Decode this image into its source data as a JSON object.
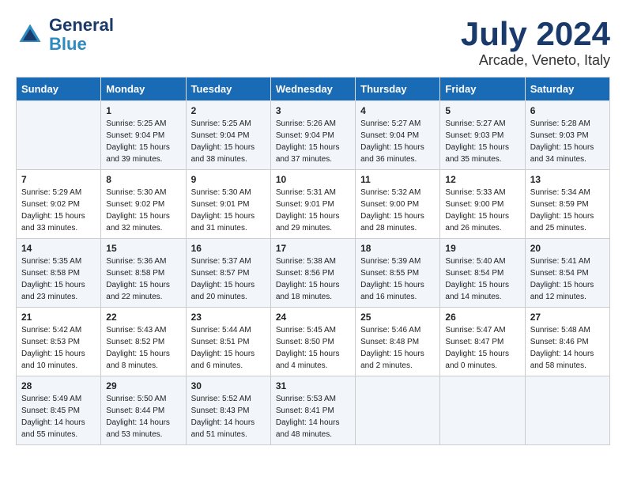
{
  "header": {
    "logo_line1": "General",
    "logo_line2": "Blue",
    "title": "July 2024",
    "subtitle": "Arcade, Veneto, Italy"
  },
  "days_of_week": [
    "Sunday",
    "Monday",
    "Tuesday",
    "Wednesday",
    "Thursday",
    "Friday",
    "Saturday"
  ],
  "weeks": [
    [
      {
        "day": "",
        "info": ""
      },
      {
        "day": "1",
        "info": "Sunrise: 5:25 AM\nSunset: 9:04 PM\nDaylight: 15 hours\nand 39 minutes."
      },
      {
        "day": "2",
        "info": "Sunrise: 5:25 AM\nSunset: 9:04 PM\nDaylight: 15 hours\nand 38 minutes."
      },
      {
        "day": "3",
        "info": "Sunrise: 5:26 AM\nSunset: 9:04 PM\nDaylight: 15 hours\nand 37 minutes."
      },
      {
        "day": "4",
        "info": "Sunrise: 5:27 AM\nSunset: 9:04 PM\nDaylight: 15 hours\nand 36 minutes."
      },
      {
        "day": "5",
        "info": "Sunrise: 5:27 AM\nSunset: 9:03 PM\nDaylight: 15 hours\nand 35 minutes."
      },
      {
        "day": "6",
        "info": "Sunrise: 5:28 AM\nSunset: 9:03 PM\nDaylight: 15 hours\nand 34 minutes."
      }
    ],
    [
      {
        "day": "7",
        "info": "Sunrise: 5:29 AM\nSunset: 9:02 PM\nDaylight: 15 hours\nand 33 minutes."
      },
      {
        "day": "8",
        "info": "Sunrise: 5:30 AM\nSunset: 9:02 PM\nDaylight: 15 hours\nand 32 minutes."
      },
      {
        "day": "9",
        "info": "Sunrise: 5:30 AM\nSunset: 9:01 PM\nDaylight: 15 hours\nand 31 minutes."
      },
      {
        "day": "10",
        "info": "Sunrise: 5:31 AM\nSunset: 9:01 PM\nDaylight: 15 hours\nand 29 minutes."
      },
      {
        "day": "11",
        "info": "Sunrise: 5:32 AM\nSunset: 9:00 PM\nDaylight: 15 hours\nand 28 minutes."
      },
      {
        "day": "12",
        "info": "Sunrise: 5:33 AM\nSunset: 9:00 PM\nDaylight: 15 hours\nand 26 minutes."
      },
      {
        "day": "13",
        "info": "Sunrise: 5:34 AM\nSunset: 8:59 PM\nDaylight: 15 hours\nand 25 minutes."
      }
    ],
    [
      {
        "day": "14",
        "info": "Sunrise: 5:35 AM\nSunset: 8:58 PM\nDaylight: 15 hours\nand 23 minutes."
      },
      {
        "day": "15",
        "info": "Sunrise: 5:36 AM\nSunset: 8:58 PM\nDaylight: 15 hours\nand 22 minutes."
      },
      {
        "day": "16",
        "info": "Sunrise: 5:37 AM\nSunset: 8:57 PM\nDaylight: 15 hours\nand 20 minutes."
      },
      {
        "day": "17",
        "info": "Sunrise: 5:38 AM\nSunset: 8:56 PM\nDaylight: 15 hours\nand 18 minutes."
      },
      {
        "day": "18",
        "info": "Sunrise: 5:39 AM\nSunset: 8:55 PM\nDaylight: 15 hours\nand 16 minutes."
      },
      {
        "day": "19",
        "info": "Sunrise: 5:40 AM\nSunset: 8:54 PM\nDaylight: 15 hours\nand 14 minutes."
      },
      {
        "day": "20",
        "info": "Sunrise: 5:41 AM\nSunset: 8:54 PM\nDaylight: 15 hours\nand 12 minutes."
      }
    ],
    [
      {
        "day": "21",
        "info": "Sunrise: 5:42 AM\nSunset: 8:53 PM\nDaylight: 15 hours\nand 10 minutes."
      },
      {
        "day": "22",
        "info": "Sunrise: 5:43 AM\nSunset: 8:52 PM\nDaylight: 15 hours\nand 8 minutes."
      },
      {
        "day": "23",
        "info": "Sunrise: 5:44 AM\nSunset: 8:51 PM\nDaylight: 15 hours\nand 6 minutes."
      },
      {
        "day": "24",
        "info": "Sunrise: 5:45 AM\nSunset: 8:50 PM\nDaylight: 15 hours\nand 4 minutes."
      },
      {
        "day": "25",
        "info": "Sunrise: 5:46 AM\nSunset: 8:48 PM\nDaylight: 15 hours\nand 2 minutes."
      },
      {
        "day": "26",
        "info": "Sunrise: 5:47 AM\nSunset: 8:47 PM\nDaylight: 15 hours\nand 0 minutes."
      },
      {
        "day": "27",
        "info": "Sunrise: 5:48 AM\nSunset: 8:46 PM\nDaylight: 14 hours\nand 58 minutes."
      }
    ],
    [
      {
        "day": "28",
        "info": "Sunrise: 5:49 AM\nSunset: 8:45 PM\nDaylight: 14 hours\nand 55 minutes."
      },
      {
        "day": "29",
        "info": "Sunrise: 5:50 AM\nSunset: 8:44 PM\nDaylight: 14 hours\nand 53 minutes."
      },
      {
        "day": "30",
        "info": "Sunrise: 5:52 AM\nSunset: 8:43 PM\nDaylight: 14 hours\nand 51 minutes."
      },
      {
        "day": "31",
        "info": "Sunrise: 5:53 AM\nSunset: 8:41 PM\nDaylight: 14 hours\nand 48 minutes."
      },
      {
        "day": "",
        "info": ""
      },
      {
        "day": "",
        "info": ""
      },
      {
        "day": "",
        "info": ""
      }
    ]
  ]
}
